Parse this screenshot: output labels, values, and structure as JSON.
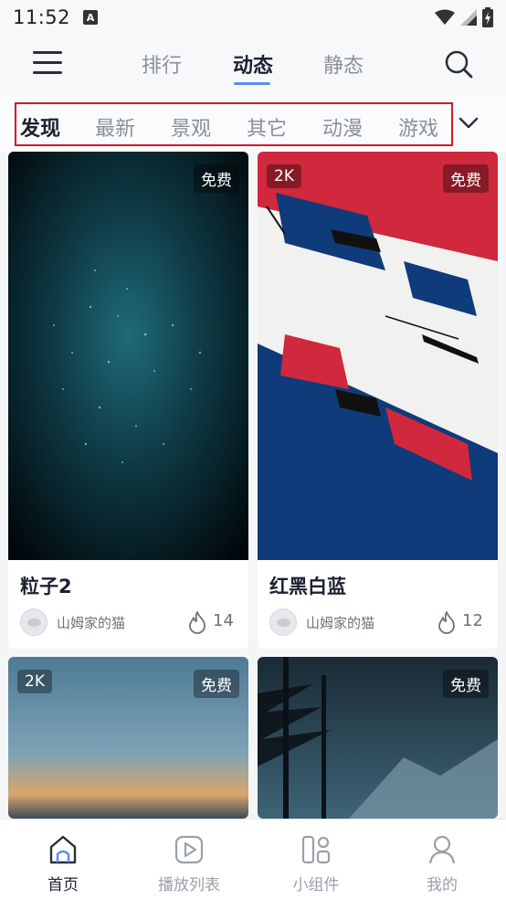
{
  "status_bar": {
    "time": "11:52",
    "notif_letter": "A"
  },
  "top_nav": {
    "tabs": [
      {
        "label": "排行"
      },
      {
        "label": "动态"
      },
      {
        "label": "静态"
      }
    ]
  },
  "categories": [
    "发现",
    "最新",
    "景观",
    "其它",
    "动漫",
    "游戏"
  ],
  "cards": [
    {
      "title": "粒子2",
      "badge_free": "免费",
      "badge_res": "",
      "author": "山姆家的猫",
      "likes": "14"
    },
    {
      "title": "红黑白蓝",
      "badge_free": "免费",
      "badge_res": "2K",
      "author": "山姆家的猫",
      "likes": "12"
    },
    {
      "title": "",
      "badge_free": "免费",
      "badge_res": "2K",
      "author": "",
      "likes": ""
    },
    {
      "title": "",
      "badge_free": "免费",
      "badge_res": "",
      "author": "",
      "likes": ""
    }
  ],
  "bottom_nav": [
    {
      "label": "首页"
    },
    {
      "label": "播放列表"
    },
    {
      "label": "小组件"
    },
    {
      "label": "我的"
    }
  ],
  "colors": {
    "accent": "#5b8dee",
    "highlight_box": "#d11a26",
    "flag_red": "#d0283c",
    "flag_blue": "#0f3b7a"
  }
}
